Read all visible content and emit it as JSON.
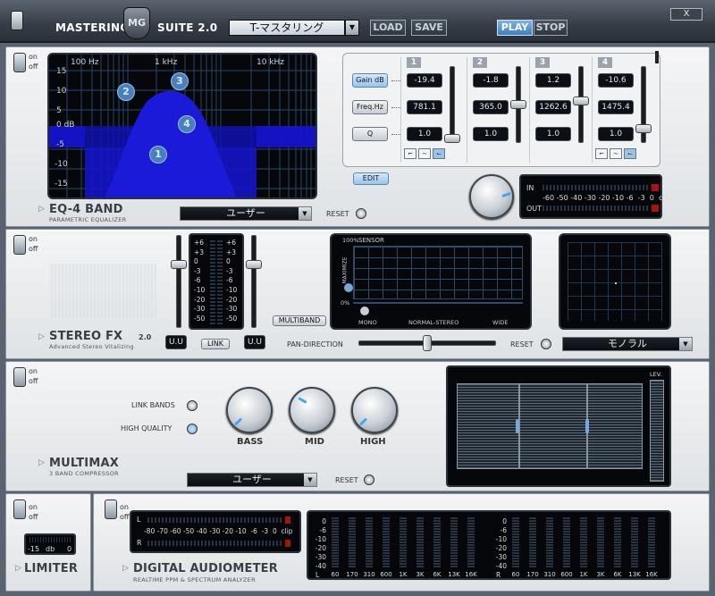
{
  "header": {
    "title_left": "MASTERING",
    "logo_text": "MG",
    "title_right": "SUITE 2.0",
    "preset": "T-マスタリング",
    "load_label": "LOAD",
    "save_label": "SAVE",
    "play_label": "PLAY",
    "stop_label": "STOP",
    "close_label": "X"
  },
  "toggle_labels": {
    "on": "on",
    "off": "off"
  },
  "eq": {
    "title": "EQ-4 BAND",
    "subtitle": "PARAMETRIC EQUALIZER",
    "freq_labels": [
      "100 Hz",
      "1 kHz",
      "10 kHz"
    ],
    "db_labels": [
      "15",
      "10",
      "5",
      "0 dB",
      "-5",
      "-10",
      "-15"
    ],
    "band_markers": [
      "1",
      "2",
      "3",
      "4"
    ],
    "preset": "ユーザー",
    "reset_label": "RESET",
    "edit_label": "EDIT",
    "row_labels": {
      "gain": "Gain dB",
      "freq": "Freq.Hz",
      "q": "Q"
    },
    "bands": [
      {
        "num": "1",
        "gain": "-19.4",
        "freq": "781.1",
        "q": "1.0",
        "level": 0.0
      },
      {
        "num": "2",
        "gain": "-1.8",
        "freq": "365.0",
        "q": "1.0",
        "level": 0.5
      },
      {
        "num": "3",
        "gain": "1.2",
        "freq": "1262.6",
        "q": "1.0",
        "level": 0.55
      },
      {
        "num": "4",
        "gain": "-10.6",
        "freq": "1475.4",
        "q": "1.0",
        "level": 0.15
      }
    ],
    "meter": {
      "in_label": "IN",
      "out_label": "OUT",
      "scale": "-60 -50 -40 -30 -20 -10 -6  -3  0  clip"
    }
  },
  "stereo": {
    "title": "STEREO FX",
    "version": "2.0",
    "subtitle": "Advanced Stereo Vitalizing",
    "scale": [
      "+6",
      "+3",
      "0",
      "-3",
      "-6",
      "-10",
      "-20",
      "-30",
      "-50"
    ],
    "link_label": "LINK",
    "left_btn": "U.U",
    "right_btn": "U.U",
    "multiband_label": "MULTIBAND",
    "sensor_label": "SENSOR",
    "sensor_pct_top": "100%",
    "sensor_pct_bottom": "0%",
    "maximize_label": "MAXIMIZE",
    "x_labels": [
      "MONO",
      "NORMAL-STEREO",
      "WIDE"
    ],
    "pan_label": "PAN-DIRECTION",
    "pan_value": 0.5,
    "reset_label": "RESET",
    "mode": "モノラル"
  },
  "multimax": {
    "title": "MULTIMAX",
    "subtitle": "3 BAND COMPRESSOR",
    "link_bands_label": "LINK BANDS",
    "high_quality_label": "HIGH QUALITY",
    "knobs": [
      {
        "label": "BASS"
      },
      {
        "label": "MID"
      },
      {
        "label": "HIGH"
      }
    ],
    "preset": "ユーザー",
    "reset_label": "RESET",
    "lev_label": "LEV."
  },
  "limiter": {
    "title": "LIMITER",
    "value": "-15",
    "unit": "db",
    "max": "0"
  },
  "audiometer": {
    "title": "DIGITAL AUDIOMETER",
    "subtitle": "REALTIME PPM & SPECTRUM ANALYZER",
    "ppm_left": "L",
    "ppm_right": "R",
    "ppm_scale": "-80 -70 -60 -50 -40 -30 -20 -10  -6  -3  0  clip",
    "spectrum_scale": [
      "0",
      "-6",
      "-10",
      "-20",
      "-30",
      "-40"
    ],
    "channel_left": "L",
    "channel_right": "R",
    "freqs": [
      "60",
      "170",
      "310",
      "600",
      "1K",
      "3K",
      "6K",
      "13K",
      "16K"
    ]
  }
}
